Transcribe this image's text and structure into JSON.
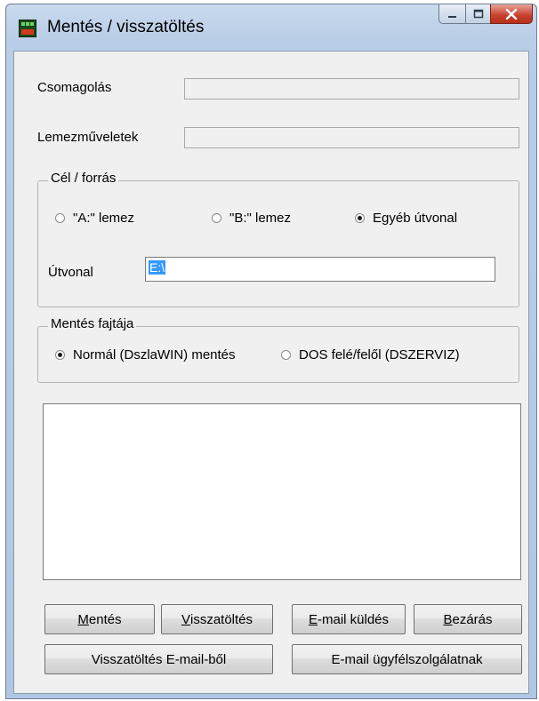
{
  "window": {
    "title": "Mentés / visszatöltés",
    "controls": [
      "minimize-icon",
      "maximize-icon",
      "close-icon"
    ]
  },
  "fields": {
    "packing_label": "Csomagolás",
    "disk_ops_label": "Lemezműveletek"
  },
  "target_group": {
    "legend": "Cél / forrás",
    "options": [
      {
        "label": "\"A:\" lemez",
        "selected": false
      },
      {
        "label": "\"B:\" lemez",
        "selected": false
      },
      {
        "label": "Egyéb útvonal",
        "selected": true
      }
    ],
    "path_label": "Útvonal",
    "path_value": "E:\\"
  },
  "save_type_group": {
    "legend": "Mentés fajtája",
    "options": [
      {
        "label": "Normál (DszlaWIN) mentés",
        "selected": true
      },
      {
        "label": "DOS felé/felől (DSZERVIZ)",
        "selected": false
      }
    ]
  },
  "buttons": {
    "save_hotkey": "M",
    "save_rest": "entés",
    "restore_hotkey": "V",
    "restore_rest": "isszatöltés",
    "email_hotkey": "E",
    "email_rest": "-mail küldés",
    "close_hotkey": "B",
    "close_rest": "ezárás",
    "restore_email": "Visszatöltés E-mail-ből",
    "email_support": "E-mail ügyfélszolgálatnak"
  },
  "colors": {
    "frame": "#b9cde6",
    "client": "#f0f0f0",
    "selection": "#3399ff",
    "close_button": "#c5402a"
  }
}
